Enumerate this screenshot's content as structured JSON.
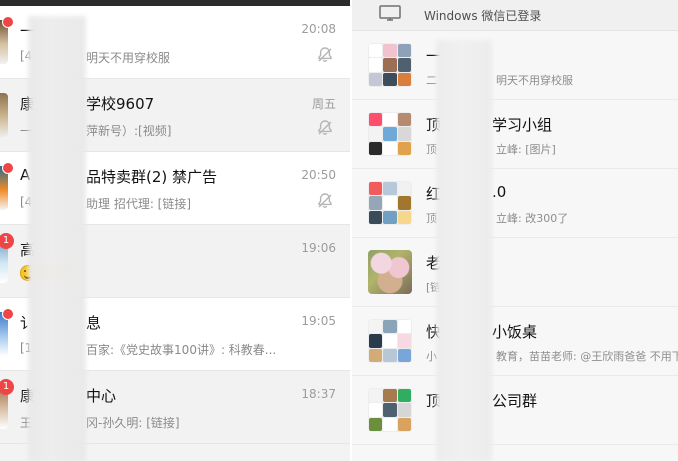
{
  "colors": {
    "unread_red": "#f04545",
    "left_bg": "#f3f3f3",
    "right_bg": "#f7f7f7",
    "title_text": "#111111",
    "secondary_text": "#8a8a8a"
  },
  "left": {
    "rows": [
      {
        "title": "一",
        "title_tail": "",
        "subtitle": "[4",
        "subtitle_tail": "明天不用穿校服",
        "time": "20:08",
        "muted": true,
        "unread_count": "",
        "show_dot": true,
        "avatar_palette": [
          "#6d4d2d",
          "#d5c2a2",
          "#f1f1f1"
        ]
      },
      {
        "title": "康",
        "title_tail": "学校9607",
        "subtitle": "一",
        "subtitle_tail": "萍新号）:[视频]",
        "time": "周五",
        "muted": true,
        "unread_count": "",
        "show_dot": false,
        "avatar_palette": [
          "#8f734f",
          "#cdb890",
          "#eeeeee"
        ]
      },
      {
        "title": "A",
        "title_tail": "品特卖群(2) 禁广告",
        "subtitle": "[4",
        "subtitle_tail": "助理 招代理: [链接]",
        "time": "20:50",
        "muted": true,
        "unread_count": "",
        "show_dot": true,
        "avatar_palette": [
          "#2a6a8c",
          "#f08c28",
          "#f5f5f5"
        ]
      },
      {
        "title": "高",
        "title_tail": "",
        "subtitle": "",
        "subtitle_tail": "",
        "time": "19:06",
        "muted": false,
        "unread_count": "1",
        "show_dot": false,
        "avatar_palette": [
          "#6e9cc7",
          "#d2e7f3",
          "#ffffff"
        ]
      },
      {
        "title": "讠",
        "title_tail": "息",
        "subtitle": "[1",
        "subtitle_tail": "百家:《党史故事100讲》: 科教春...",
        "time": "19:05",
        "muted": false,
        "unread_count": "",
        "show_dot": true,
        "avatar_palette": [
          "#3a78c5",
          "#a5c9ef",
          "#ffffff"
        ]
      },
      {
        "title": "康",
        "title_tail": "中心",
        "subtitle": "王",
        "subtitle_tail": "冈-孙久明: [链接]",
        "time": "18:37",
        "muted": false,
        "unread_count": "1",
        "show_dot": false,
        "avatar_palette": [
          "#9e6f45",
          "#d9c1a6",
          "#ffffff"
        ]
      }
    ]
  },
  "right": {
    "header": {
      "label": "Windows 微信已登录",
      "icon": "monitor-icon"
    },
    "rows": [
      {
        "title": "一",
        "title_tail": "",
        "subtitle": "二",
        "subtitle_tail": "明天不用穿校服",
        "avatar_type": "grid",
        "avatar_colors": [
          "#ffffff",
          "#f0c3cf",
          "#8da1b9",
          "#ffffff",
          "#9c6f55",
          "#4f6171",
          "#c2c9d5",
          "#3e4d5b",
          "#d97e3d"
        ]
      },
      {
        "title": "顶",
        "title_tail": "学习小组",
        "subtitle": "顶",
        "subtitle_tail": "立峰: [图片]",
        "avatar_type": "grid",
        "avatar_colors": [
          "#ff4d6d",
          "#ffffff",
          "#b58a70",
          "#f3f3f3",
          "#6fa9d8",
          "#d8d8d8",
          "#2b2b2b",
          "#ffffff",
          "#e1a24d"
        ]
      },
      {
        "title": "红",
        "title_tail": ".0",
        "subtitle": "顶",
        "subtitle_tail": "立峰: 改300了",
        "avatar_type": "grid",
        "avatar_colors": [
          "#f15b5b",
          "#b7c9d8",
          "#f1f1f1",
          "#95a6b7",
          "#ffffff",
          "#a0772d",
          "#3a4b5a",
          "#70a0c4",
          "#f7d78c"
        ]
      },
      {
        "title": "老",
        "title_tail": "",
        "subtitle": "[链",
        "subtitle_tail": "",
        "avatar_type": "photo",
        "avatar_colors": []
      },
      {
        "title": "快",
        "title_tail": "小饭桌",
        "subtitle": "小",
        "subtitle_tail": "教育，苗苗老师: @王欣雨爸爸 不用下载...",
        "avatar_type": "grid",
        "avatar_colors": [
          "#f4f4f4",
          "#8aa4b8",
          "#ffffff",
          "#2a3c4c",
          "#ffffff",
          "#f7d9e3",
          "#d3ab77",
          "#b7c7d5",
          "#78a6d8"
        ]
      },
      {
        "title": "顶",
        "title_tail": "公司群",
        "subtitle": "",
        "subtitle_tail": "",
        "avatar_type": "grid",
        "avatar_colors": [
          "#f3f3f3",
          "#a67b4f",
          "#2fae62",
          "#ffffff",
          "#4f6171",
          "#d6d6d6",
          "#6b8f3d",
          "#ffffff",
          "#d9a25f"
        ]
      }
    ]
  }
}
